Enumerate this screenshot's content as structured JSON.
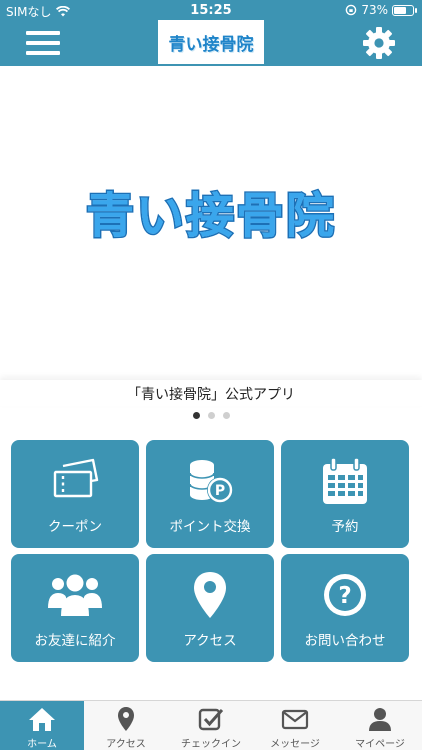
{
  "status_bar": {
    "carrier": "SIMなし",
    "time": "15:25",
    "battery": "73%",
    "battery_level": 0.73
  },
  "header": {
    "logo_text": "青い接骨院"
  },
  "hero": {
    "logo_text": "青い接骨院"
  },
  "caption": "「青い接骨院」公式アプリ",
  "carousel": {
    "count": 3,
    "active_index": 0
  },
  "tiles": [
    {
      "label": "クーポン",
      "icon": "ticket-icon"
    },
    {
      "label": "ポイント交換",
      "icon": "coins-point-icon"
    },
    {
      "label": "予約",
      "icon": "calendar-icon"
    },
    {
      "label": "お友達に紹介",
      "icon": "friends-icon"
    },
    {
      "label": "アクセス",
      "icon": "map-pin-icon"
    },
    {
      "label": "お問い合わせ",
      "icon": "question-icon"
    }
  ],
  "tab_bar": {
    "items": [
      {
        "label": "ホーム",
        "icon": "home-icon",
        "active": true
      },
      {
        "label": "アクセス",
        "icon": "map-pin-icon",
        "active": false
      },
      {
        "label": "チェックイン",
        "icon": "checkin-icon",
        "active": false
      },
      {
        "label": "メッセージ",
        "icon": "mail-icon",
        "active": false
      },
      {
        "label": "マイページ",
        "icon": "person-icon",
        "active": false
      }
    ]
  },
  "colors": {
    "primary": "#3d94b3",
    "logo_blue": "#2a8fd8",
    "background": "#ffffff",
    "tab_bar_bg": "#f7f7f7"
  }
}
